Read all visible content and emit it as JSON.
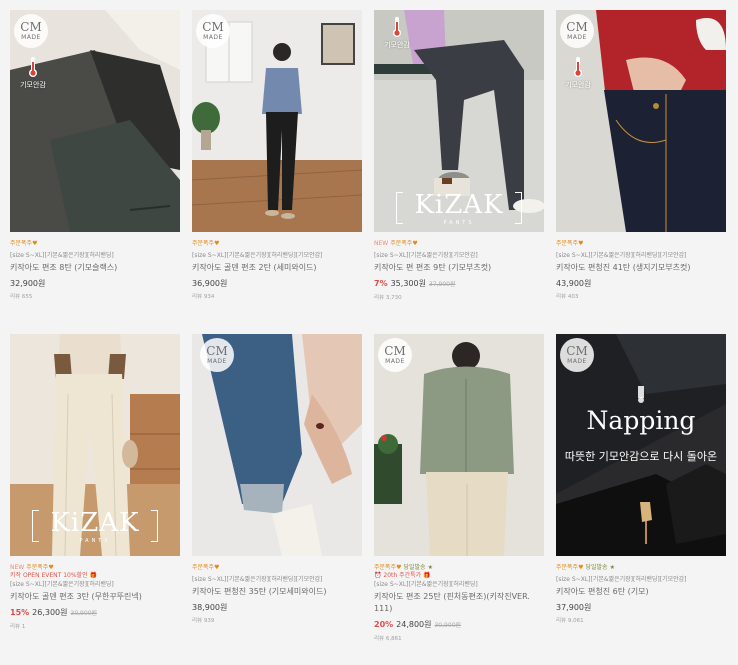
{
  "products": [
    {
      "labels": {
        "new": "",
        "recommend": "주문폭주",
        "hot": ""
      },
      "event": "",
      "size": "[size S~XL][기본&짧은기장][허리밴딩]",
      "name": "키작아도 편조 8탄 (기모슬랙스)",
      "discount": "",
      "price": "32,900원",
      "original": "",
      "reviews": "리뷰 655",
      "badges": {
        "cm": true,
        "fleece": "기모안감",
        "kizak": false
      }
    },
    {
      "labels": {
        "new": "",
        "recommend": "주문폭주",
        "hot": ""
      },
      "event": "",
      "size": "[size S~XL][기본&짧은기장][허리밴딩][기모안감]",
      "name": "키작아도 골덴 편조 2탄 (세미와이드)",
      "discount": "",
      "price": "36,900원",
      "original": "",
      "reviews": "리뷰 934",
      "badges": {
        "cm": true,
        "fleece": "",
        "kizak": false
      }
    },
    {
      "labels": {
        "new": "NEW",
        "recommend": "주문폭주",
        "hot": ""
      },
      "event": "",
      "size": "[size S~XL][기본&짧은기장][기모안감]",
      "name": "키작아도 편 편조 9탄 (기모부츠컷)",
      "discount": "7%",
      "price": "35,300원",
      "original": "37,900원",
      "reviews": "리뷰 3,730",
      "badges": {
        "cm": false,
        "fleece": "기모안감",
        "kizak": true
      }
    },
    {
      "labels": {
        "new": "",
        "recommend": "주문폭주",
        "hot": ""
      },
      "event": "",
      "size": "[size S~XL][기본&짧은기장][허리밴딩][기모안감]",
      "name": "키작아도 편청진 41탄 (생지기모부츠컷)",
      "discount": "",
      "price": "43,900원",
      "original": "",
      "reviews": "리뷰 403",
      "badges": {
        "cm": true,
        "fleece": "기모안감",
        "kizak": false
      }
    },
    {
      "labels": {
        "new": "NEW",
        "recommend": "주문폭주",
        "hot": ""
      },
      "event": "키작 OPEN EVENT 10%할인",
      "size": "[size S~XL][기본&짧은기장][허리밴딩]",
      "name": "키작아도 골덴 편조 3탄 (무한꾸뚜린넥)",
      "discount": "15%",
      "price": "26,300원",
      "original": "30,900원",
      "reviews": "리뷰 1",
      "badges": {
        "cm": false,
        "fleece": "",
        "kizak": true
      }
    },
    {
      "labels": {
        "new": "",
        "recommend": "주문폭주",
        "hot": ""
      },
      "event": "",
      "size": "[size S~XL][기본&짧은기장][허리밴딩][기모안감]",
      "name": "키작아도 편청진 35탄 (기모세미와이드)",
      "discount": "",
      "price": "38,900원",
      "original": "",
      "reviews": "리뷰 939",
      "badges": {
        "cm": true,
        "fleece": "",
        "kizak": false
      }
    },
    {
      "labels": {
        "new": "",
        "recommend": "주문폭주",
        "hot": "당일발송"
      },
      "event": "20th 주간특가",
      "size": "[size S~XL][기본&짧은기장][허리밴딩]",
      "name": "키작아도 편조 25탄 (핀처동편조)(키작진VER. 111)",
      "discount": "20%",
      "price": "24,800원",
      "original": "30,900원",
      "reviews": "리뷰 6,861",
      "badges": {
        "cm": true,
        "fleece": "",
        "kizak": false
      }
    },
    {
      "labels": {
        "new": "",
        "recommend": "주문폭주",
        "hot": "당일발송"
      },
      "event": "",
      "size": "[size S~XL][기본&짧은기장][허리밴딩][기모안감]",
      "name": "키작아도 편청진 6탄 (기모)",
      "discount": "",
      "price": "37,900원",
      "original": "",
      "reviews": "리뷰 9,061",
      "badges": {
        "cm": true,
        "fleece": "",
        "kizak": false
      }
    }
  ],
  "badge_text": {
    "cm_logo": "CM",
    "cm_made": "MADE",
    "kizak_word": "KiZAK",
    "kizak_sub": "PANTS"
  },
  "napping": {
    "title": "Napping",
    "subtitle": "따뜻한 기모안감으로 다시 돌아온"
  },
  "colors": {
    "recommend": "#e38a1a",
    "new": "#f08a7e",
    "discount": "#e24b4b",
    "hot": "#7c8a3a",
    "background": "#f4f4f4"
  }
}
